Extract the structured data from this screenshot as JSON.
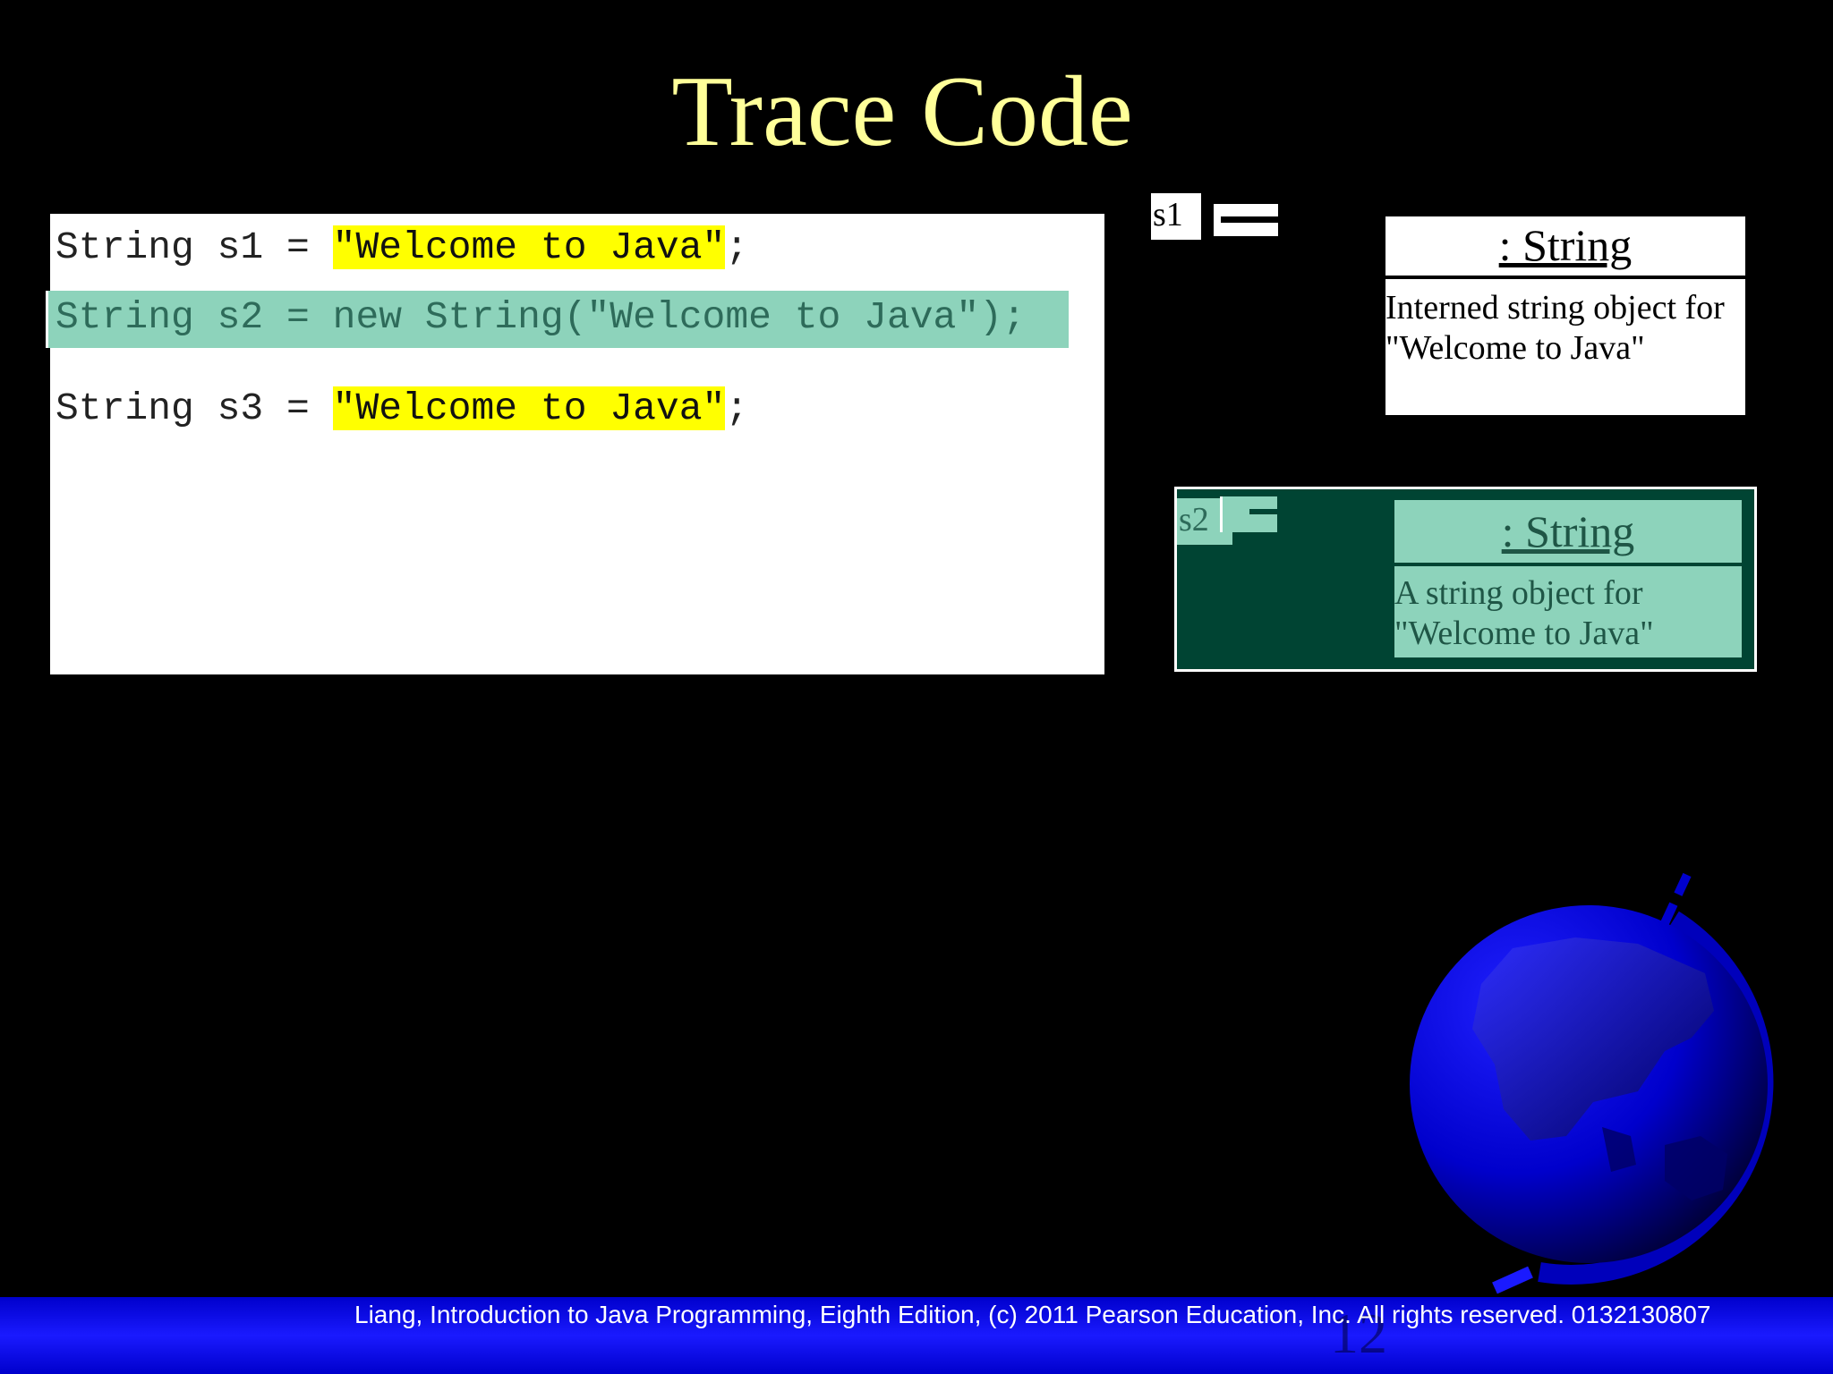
{
  "slide": {
    "title": "Trace Code",
    "code": {
      "line1": {
        "prefix": "String s1 = ",
        "literal": "\"Welcome to Java\"",
        "suffix": ";"
      },
      "line2": {
        "text": "String s2 = new String(\"Welcome to Java\");"
      },
      "line3": {
        "prefix": "String s3 = ",
        "literal": "\"Welcome to Java\"",
        "suffix": ";"
      }
    },
    "references": {
      "s1": "s1",
      "s2": "s2"
    },
    "objects": {
      "interned": {
        "header": ": String",
        "body_line1": "Interned string object for",
        "body_line2": "\"Welcome to Java\""
      },
      "new_object": {
        "header": ": String",
        "body_line1": "A string object for",
        "body_line2": "\"Welcome to Java\""
      }
    },
    "footer": "Liang, Introduction to Java Programming, Eighth Edition, (c) 2011 Pearson Education, Inc. All rights reserved. 0132130807",
    "page_number": "12",
    "colors": {
      "title": "#FFFF99",
      "literal_highlight": "#FFFF00",
      "active_line": "#8DD3BB",
      "s2_panel": "#004433",
      "footer_bar": "#0000CC"
    },
    "decoration": "globe-icon"
  }
}
